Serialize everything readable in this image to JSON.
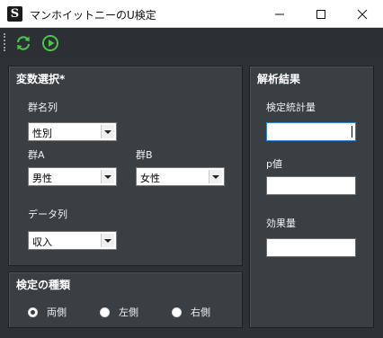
{
  "window": {
    "title": "マンホイットニーのU検定",
    "app_icon_letter": "S",
    "controls": [
      "minimize-icon",
      "maximize-icon",
      "close-icon"
    ]
  },
  "toolbar": {
    "icons": [
      "refresh-icon",
      "run-icon"
    ],
    "colors": {
      "icon_green": "#4cc24c"
    }
  },
  "variables": {
    "title": "変数選択*",
    "group_column_label": "群名列",
    "group_column_value": "性別",
    "group_a_label": "群A",
    "group_a_value": "男性",
    "group_b_label": "群B",
    "group_b_value": "女性",
    "data_column_label": "データ列",
    "data_column_value": "収入"
  },
  "test_type": {
    "title": "検定の種類",
    "options": [
      "両側",
      "左側",
      "右側"
    ],
    "selected": "両側"
  },
  "results": {
    "title": "解析結果",
    "statistic_label": "検定統計量",
    "statistic_value": "",
    "p_label": "p値",
    "p_value": "",
    "effect_label": "効果量",
    "effect_value": ""
  },
  "colors": {
    "background": "#2c3034",
    "panel": "#3a3f44",
    "text": "#f0f0f0",
    "focus": "#2f84d8"
  }
}
